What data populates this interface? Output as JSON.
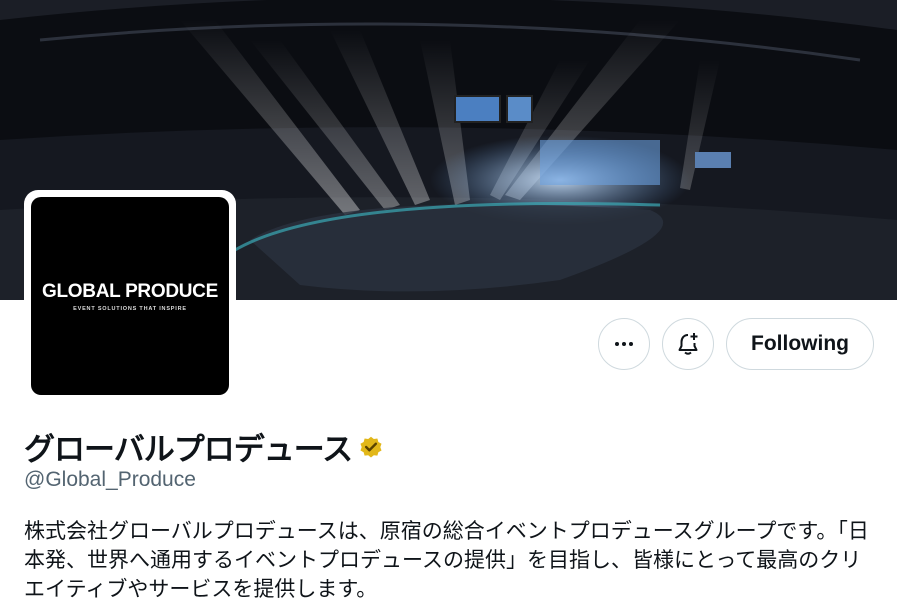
{
  "profile": {
    "banner": {
      "description_icon": "concert-arena-banner"
    },
    "avatar": {
      "logo_main": "GLOBAL PRODUCE",
      "logo_sub": "EVENT SOLUTIONS THAT INSPIRE"
    },
    "actions": {
      "more_icon": "more-icon",
      "notify_icon": "bell-plus-icon",
      "follow_label": "Following"
    },
    "name": "グローバルプロデュース",
    "verified_badge": "verified-gold-icon",
    "handle": "@Global_Produce",
    "bio": "株式会社グローバルプロデュースは、原宿の総合イベントプロデュースグループです。「日本発、世界へ通用するイベントプロデュースの提供」を目指し、皆様にとって最高のクリエイティブやサービスを提供します。",
    "colors": {
      "verified_gold": "#e2b719",
      "border": "#cfd9de",
      "secondary_text": "#536471"
    }
  }
}
